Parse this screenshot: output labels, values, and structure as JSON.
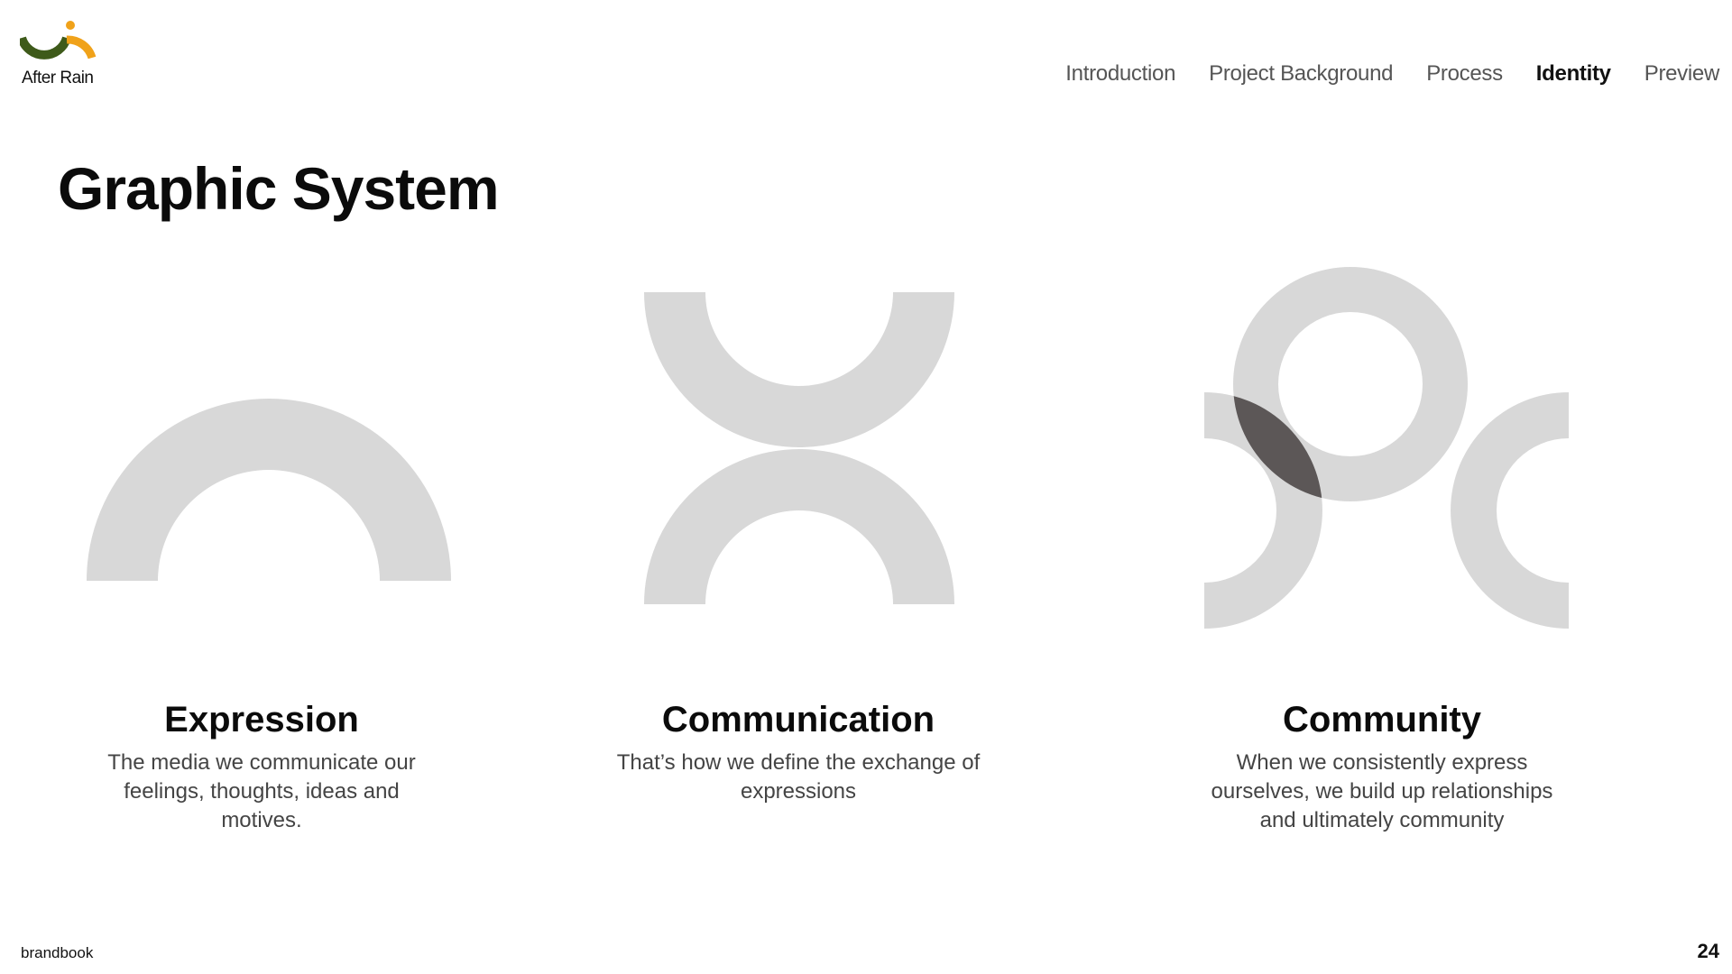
{
  "brand": {
    "logo_text": "After Rain",
    "colors": {
      "green": "#3e5a1a",
      "orange": "#f0a21a"
    }
  },
  "nav": {
    "items": [
      {
        "label": "Introduction",
        "active": false
      },
      {
        "label": "Project Background",
        "active": false
      },
      {
        "label": "Process",
        "active": false
      },
      {
        "label": "Identity",
        "active": true
      },
      {
        "label": "Preview",
        "active": false
      }
    ]
  },
  "page": {
    "title": "Graphic System"
  },
  "graphics": {
    "shape_color": "#d8d8d8",
    "overlap_color": "#5c5757"
  },
  "sections": [
    {
      "title": "Expression",
      "description": "The media we communicate our feelings, thoughts, ideas and motives."
    },
    {
      "title": "Communication",
      "description": "That’s how we define the exchange of expressions"
    },
    {
      "title": "Community",
      "description": "When we consistently express ourselves, we build up relationships and ultimately community"
    }
  ],
  "footer": {
    "label": "brandbook",
    "page_number": "24"
  }
}
